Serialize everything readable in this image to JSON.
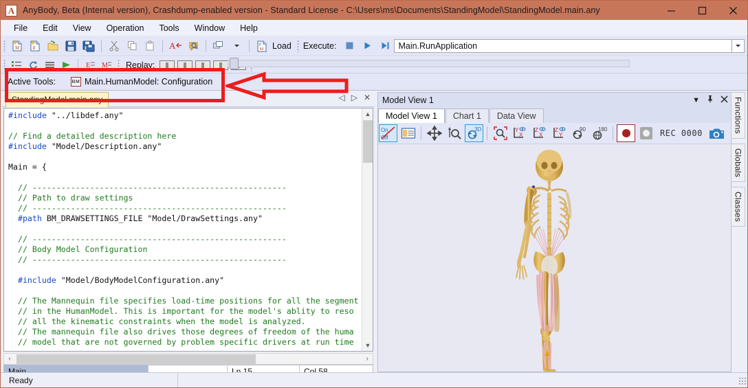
{
  "window": {
    "app_icon": "A",
    "title": "AnyBody, Beta (Internal version), Crashdump-enabled version  -  Standard License  -  C:\\Users\\ms\\Documents\\StandingModel\\StandingModel.main.any",
    "minimize": "minimize-icon",
    "maximize": "maximize-icon",
    "close": "close-icon"
  },
  "menu": {
    "items": [
      "File",
      "Edit",
      "View",
      "Operation",
      "Tools",
      "Window",
      "Help"
    ]
  },
  "toolbar": {
    "load_label": "Load",
    "execute_label": "Execute:",
    "execute_value": "Main.RunApplication",
    "replay_label": "Replay:"
  },
  "active_tools": {
    "label": "Active Tools:",
    "icon_text": "BM",
    "value": "Main.HumanModel: Configuration"
  },
  "editor": {
    "tab_label": "StandingModel.main.any",
    "nav_prev": "◁",
    "nav_next": "▷",
    "nav_close": "✕",
    "code_lines": [
      {
        "t": "kw",
        "s": "#include"
      },
      {
        "t": "pln",
        "s": " \"../libdef.any\""
      },
      {
        "t": "nl"
      },
      {
        "t": "nl"
      },
      {
        "t": "cm",
        "s": "// Find a detailed description here"
      },
      {
        "t": "nl"
      },
      {
        "t": "kw",
        "s": "#include"
      },
      {
        "t": "pln",
        "s": " \"Model/Description.any\""
      },
      {
        "t": "nl"
      },
      {
        "t": "nl"
      },
      {
        "t": "pln",
        "s": "Main = {"
      },
      {
        "t": "nl"
      },
      {
        "t": "nl"
      },
      {
        "t": "cm",
        "s": "  // -----------------------------------------------------"
      },
      {
        "t": "nl"
      },
      {
        "t": "cm",
        "s": "  // Path to draw settings"
      },
      {
        "t": "nl"
      },
      {
        "t": "cm",
        "s": "  // -----------------------------------------------------"
      },
      {
        "t": "nl"
      },
      {
        "t": "kw",
        "s": "  #path"
      },
      {
        "t": "pln",
        "s": " BM_DRAWSETTINGS_FILE \"Model/DrawSettings.any\""
      },
      {
        "t": "nl"
      },
      {
        "t": "nl"
      },
      {
        "t": "cm",
        "s": "  // -----------------------------------------------------"
      },
      {
        "t": "nl"
      },
      {
        "t": "cm",
        "s": "  // Body Model Configuration"
      },
      {
        "t": "nl"
      },
      {
        "t": "cm",
        "s": "  // -----------------------------------------------------"
      },
      {
        "t": "nl"
      },
      {
        "t": "nl"
      },
      {
        "t": "kw",
        "s": "  #include"
      },
      {
        "t": "pln",
        "s": " \"Model/BodyModelConfiguration.any\""
      },
      {
        "t": "nl"
      },
      {
        "t": "nl"
      },
      {
        "t": "cm",
        "s": "  // The Mannequin file specifies load-time positions for all the segment"
      },
      {
        "t": "nl"
      },
      {
        "t": "cm",
        "s": "  // in the HumanModel. This is important for the model's ablity to reso"
      },
      {
        "t": "nl"
      },
      {
        "t": "cm",
        "s": "  // all the kinematic constraints when the model is analyzed."
      },
      {
        "t": "nl"
      },
      {
        "t": "cm",
        "s": "  // The mannequin file also drives those degrees of freedom of the huma"
      },
      {
        "t": "nl"
      },
      {
        "t": "cm",
        "s": "  // model that are not governed by problem specific drivers at run time"
      }
    ],
    "status": {
      "scope": "Main",
      "blank": "",
      "line": "Ln 15",
      "column": "Col 58"
    }
  },
  "model_view": {
    "panel_title": "Model View 1",
    "header_buttons": [
      "dropdown-icon",
      "pin-icon",
      "close-icon"
    ],
    "tabs": [
      {
        "label": "Model View 1",
        "active": true
      },
      {
        "label": "Chart 1",
        "active": false
      },
      {
        "label": "Data View",
        "active": false
      }
    ],
    "toolbar_icons": [
      "on-off-toggle-icon",
      "properties-icon",
      "pan-icon",
      "zoom-select-icon",
      "rotate-3d-icon",
      "zoom-window-icon",
      "view-yx-icon",
      "view-zx-icon",
      "view-zy-icon",
      "rotate-90-icon",
      "rotate-180-icon",
      "record-icon",
      "stop-record-icon",
      "camera-icon"
    ],
    "rec_label": "REC 0000",
    "view_labels": {
      "yx": "Y",
      "yx_sub": "X",
      "zx": "Z",
      "zx_sub": "X",
      "zy": "Z",
      "zy_sub": "Y",
      "rot90": "90",
      "rot180": "180",
      "rot3d": "3D",
      "on": "On",
      "off": "Off"
    }
  },
  "dock_tabs": {
    "items": [
      "Functions",
      "Globals",
      "Classes"
    ]
  },
  "statusbar": {
    "ready": "Ready"
  },
  "annotations": {
    "highlight_color": "#EE1C1C",
    "rect_target": "active-tools-bar",
    "arrow_direction": "left"
  }
}
